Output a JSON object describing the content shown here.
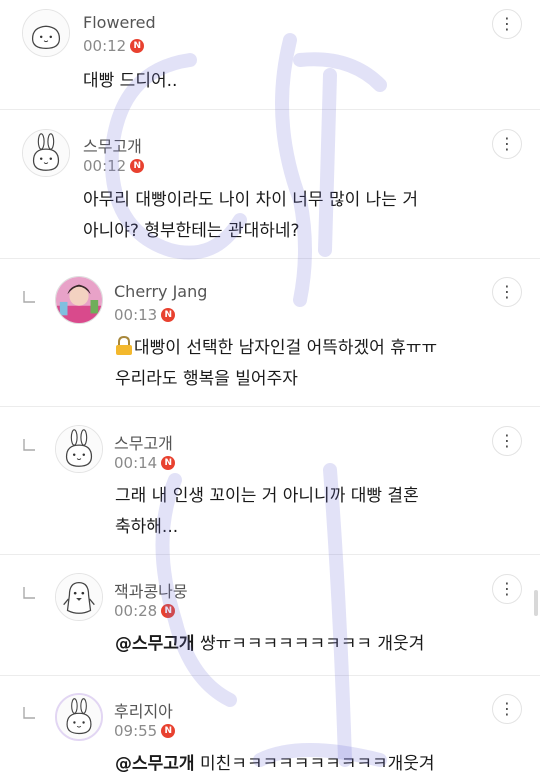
{
  "comments": [
    {
      "name": "Flowered",
      "time": "00:12",
      "badge": "N",
      "lines": [
        "대빵 드디어.."
      ],
      "avatar_icon": "bunny-face-icon"
    },
    {
      "name": "스무고개",
      "time": "00:12",
      "badge": "N",
      "lines": [
        "아무리 대빵이라도 나이 차이 너무 많이 나는 거",
        "아니야? 형부한테는 관대하네?"
      ],
      "avatar_icon": "bunny-icon"
    },
    {
      "name": "Cherry Jang",
      "time": "00:13",
      "badge": "N",
      "lines": [
        "대빵이 선택한 남자인걸 어뜩하겠어 휴ㅠㅠ",
        "우리라도 행복을 빌어주자"
      ],
      "avatar_icon": "profile-photo-icon",
      "lead_icon": "lock-icon"
    },
    {
      "name": "스무고개",
      "time": "00:14",
      "badge": "N",
      "lines": [
        "그래 내 인생 꼬이는 거 아니니까 대빵 결혼",
        "축하해..."
      ],
      "avatar_icon": "bunny-icon"
    },
    {
      "name": "잭과콩나뭉",
      "time": "00:28",
      "badge": "N",
      "mention": "@스무고개",
      "text": " 썅ㅠㅋㅋㅋㅋㅋㅋㅋㅋㅋ 개웃겨",
      "avatar_icon": "penguin-icon"
    },
    {
      "name": "후리지아",
      "time": "09:55",
      "badge": "N",
      "mention": "@스무고개",
      "text": " 미친ㅋㅋㅋㅋㅋㅋㅋㅋㅋㅋ개웃겨",
      "avatar_icon": "bunny-icon"
    }
  ],
  "colors": {
    "badge": "#e8412f",
    "divider": "#ececec",
    "overlay_scribble": "#6f6fd8",
    "time": "#8a8a8a"
  }
}
